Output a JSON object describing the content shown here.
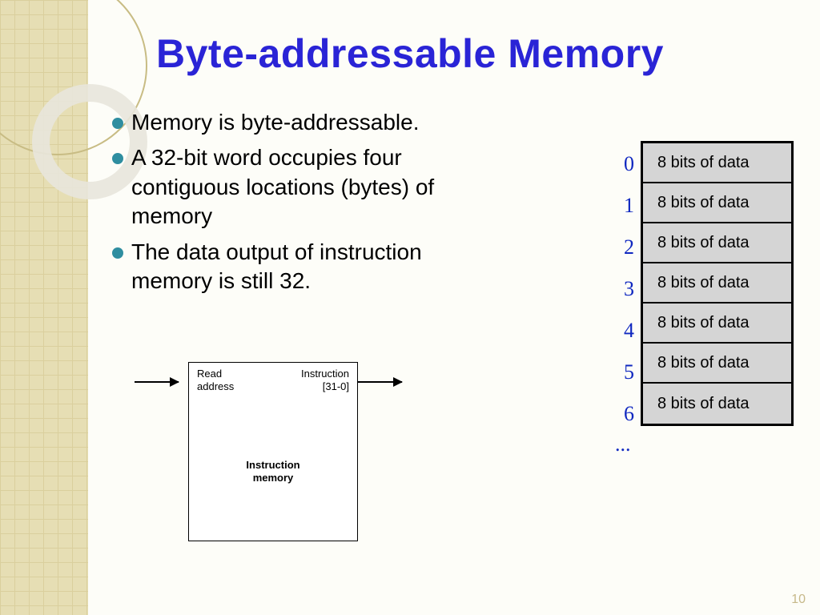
{
  "title": "Byte-addressable Memory",
  "bullets": [
    "Memory is byte-addressable.",
    "A 32-bit word occupies four contiguous locations (bytes) of memory",
    "The data output of instruction memory is still 32."
  ],
  "instruction_block": {
    "input_label_l1": "Read",
    "input_label_l2": "address",
    "output_label_l1": "Instruction",
    "output_label_l2": "[31-0]",
    "center_l1": "Instruction",
    "center_l2": "memory"
  },
  "memory_cells": {
    "indices": [
      "0",
      "1",
      "2",
      "3",
      "4",
      "5",
      "6"
    ],
    "cell_label": "8 bits of data",
    "ellipsis": "..."
  },
  "page_number": "10"
}
